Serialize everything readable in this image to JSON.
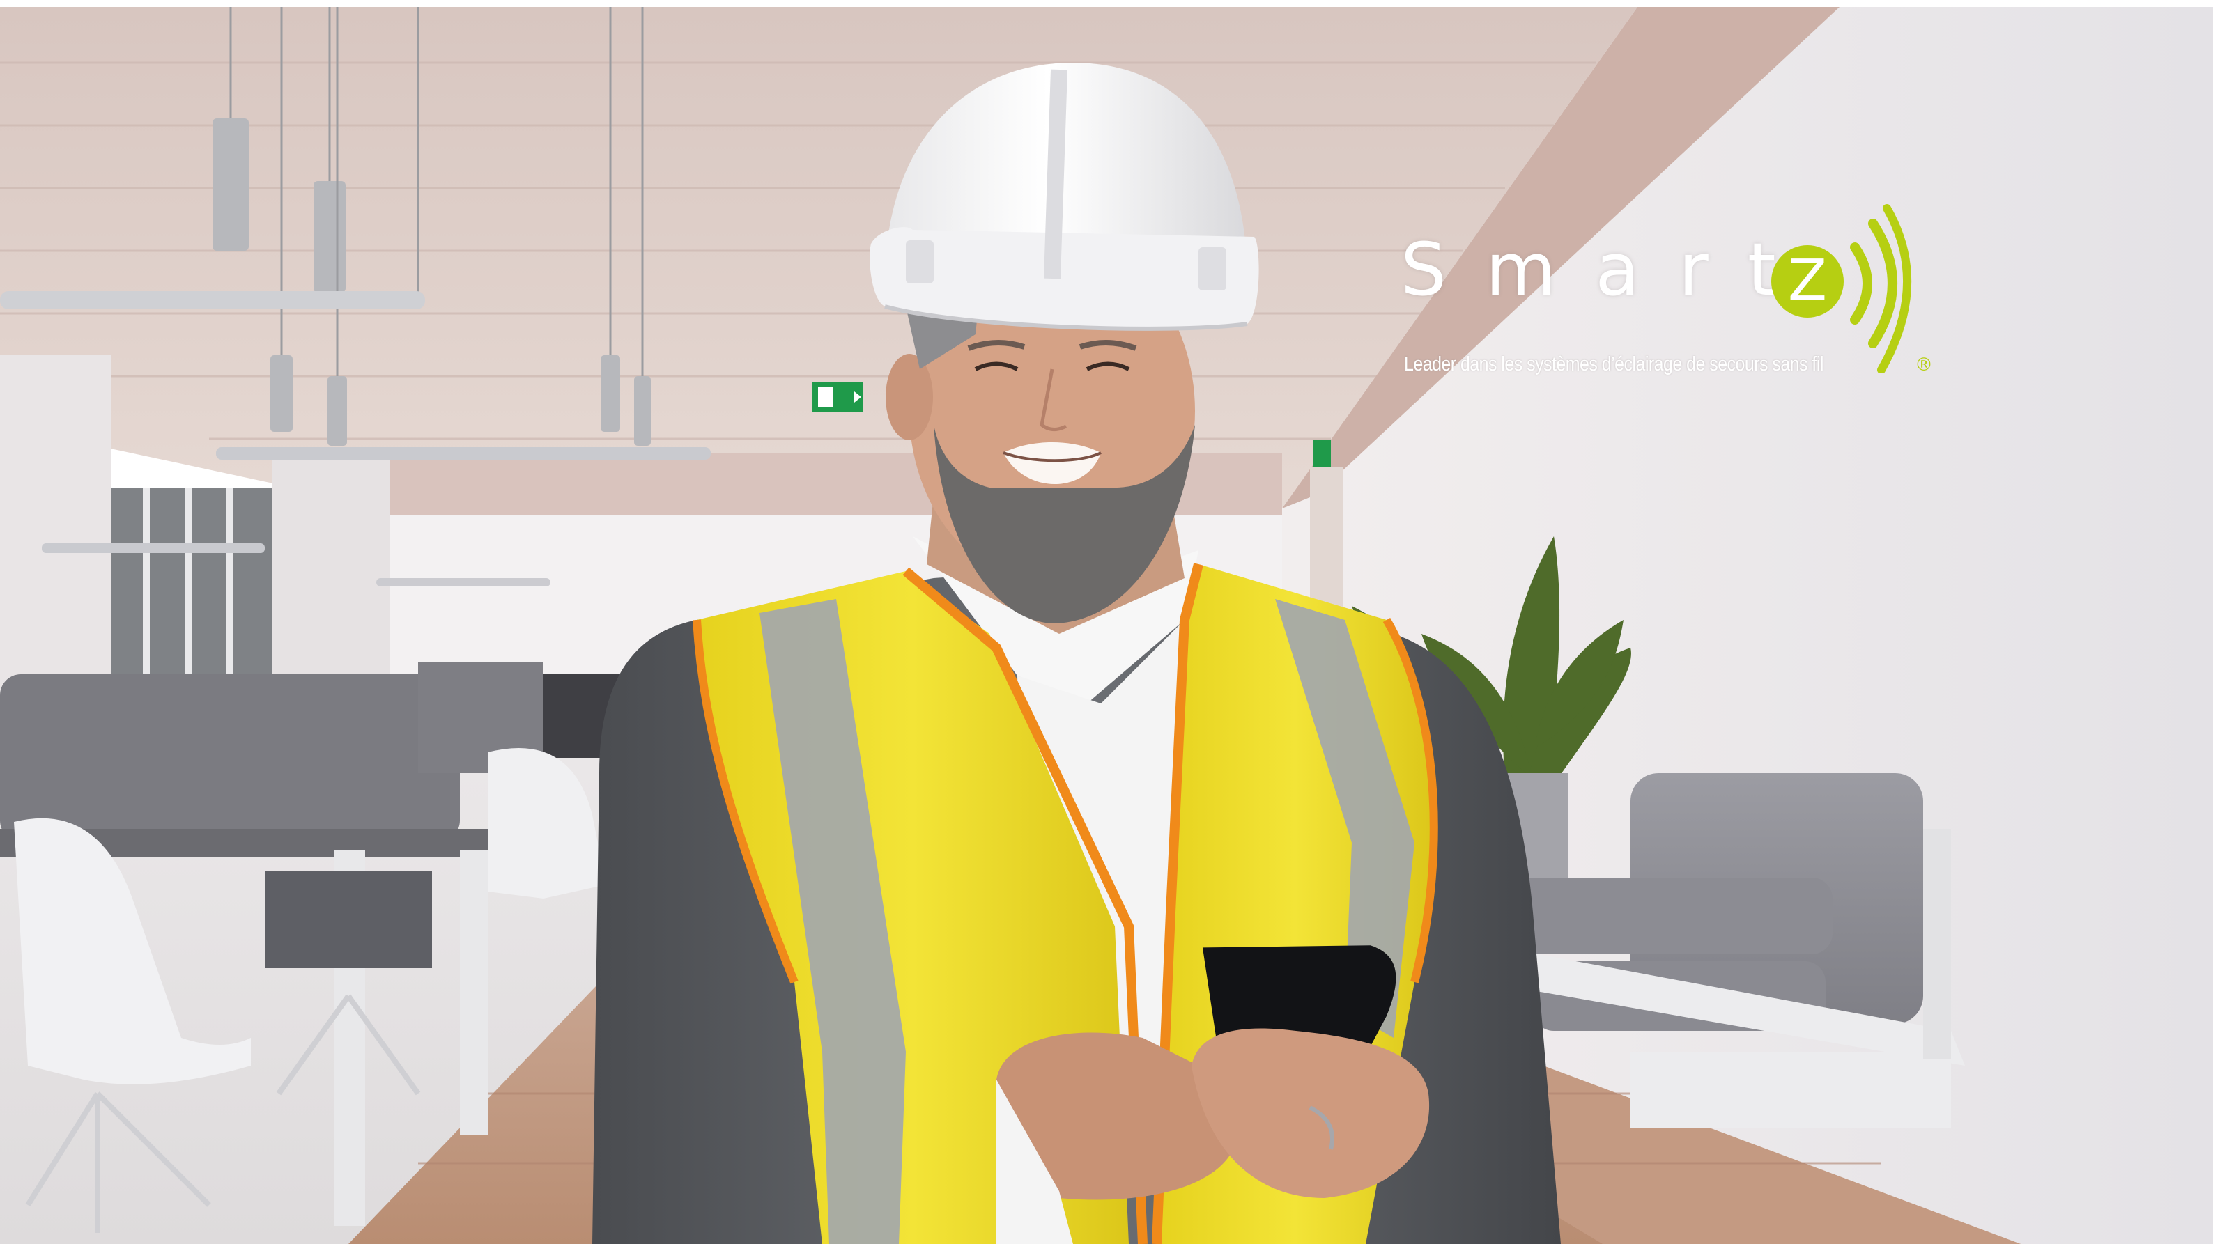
{
  "brand": {
    "wordmark": "Smart",
    "badge_letter": "Z",
    "tagline": "Leader dans les systèmes d’éclairage de secours sans fil",
    "registered_mark": "®",
    "accent_color": "#b6cf12"
  },
  "scene": {
    "exit_sign_icon": "emergency-exit-sign-icon"
  }
}
